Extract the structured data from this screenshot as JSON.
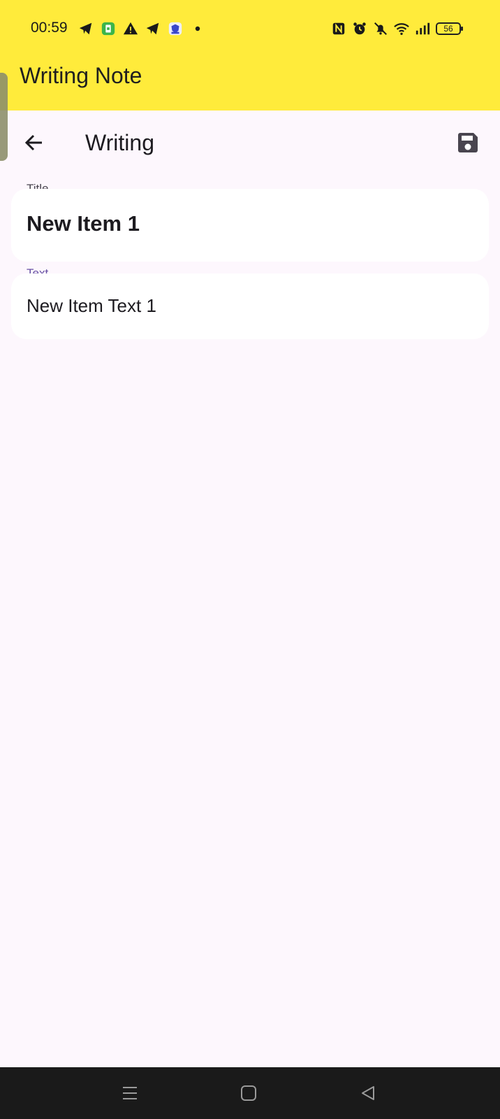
{
  "status_bar": {
    "time": "00:59",
    "battery": "56",
    "left_icons": [
      "telegram-icon",
      "app-store-icon",
      "warning-icon",
      "telegram-icon",
      "shield-app-icon",
      "dot-icon"
    ],
    "right_icons": [
      "nfc-icon",
      "alarm-icon",
      "mute-icon",
      "wifi-icon",
      "signal-icon"
    ]
  },
  "app_header": {
    "title": "Writing Note"
  },
  "toolbar": {
    "title": "Writing",
    "back_icon": "arrow-left-icon",
    "save_icon": "floppy-disk-icon"
  },
  "form": {
    "title_field": {
      "label": "Title",
      "value": "New Item 1"
    },
    "text_field": {
      "label": "Text",
      "value": "New Item Text 1"
    }
  },
  "nav_bar": {
    "icons": [
      "menu-icon",
      "home-icon",
      "back-icon"
    ]
  },
  "colors": {
    "header_yellow": "#ffeb3b",
    "page_background": "#fdf7fd",
    "focus_label": "#6750a4",
    "nav_bar": "#1a1a1a"
  }
}
